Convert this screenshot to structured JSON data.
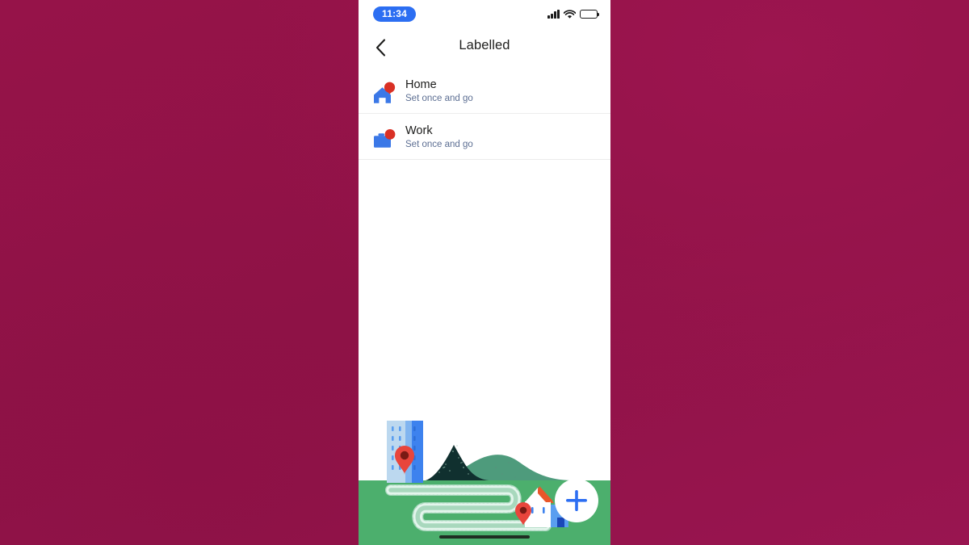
{
  "backdrop": {
    "color": "#96134b"
  },
  "status_bar": {
    "time": "11:34",
    "time_pill_color": "#2c6ef2",
    "icons": [
      "signal-icon",
      "wifi-icon",
      "battery-icon"
    ]
  },
  "nav": {
    "back_icon": "chevron-left-icon",
    "title": "Labelled"
  },
  "list": {
    "items": [
      {
        "icon": "home-pin-icon",
        "title": "Home",
        "subtitle": "Set once and go"
      },
      {
        "icon": "work-pin-icon",
        "title": "Work",
        "subtitle": "Set once and go"
      }
    ]
  },
  "illustration": {
    "name": "map-places-illustration",
    "sky_color": "#ffffff",
    "grass_color": "#4caf6d",
    "path_color": "#a8d8bd",
    "building_color": "#bcd8ef",
    "building_side_color": "#3d82ee",
    "mountain_color": "#10302f",
    "hill_color": "#4e9b7c",
    "house_color": "#ffffff",
    "roof_color": "#e8562a",
    "pin_color": "#e13c2f"
  },
  "fab": {
    "icon": "plus-icon",
    "color": "#2c6ef2",
    "background": "#ffffff"
  },
  "home_indicator": {
    "color": "#1f2d22"
  }
}
